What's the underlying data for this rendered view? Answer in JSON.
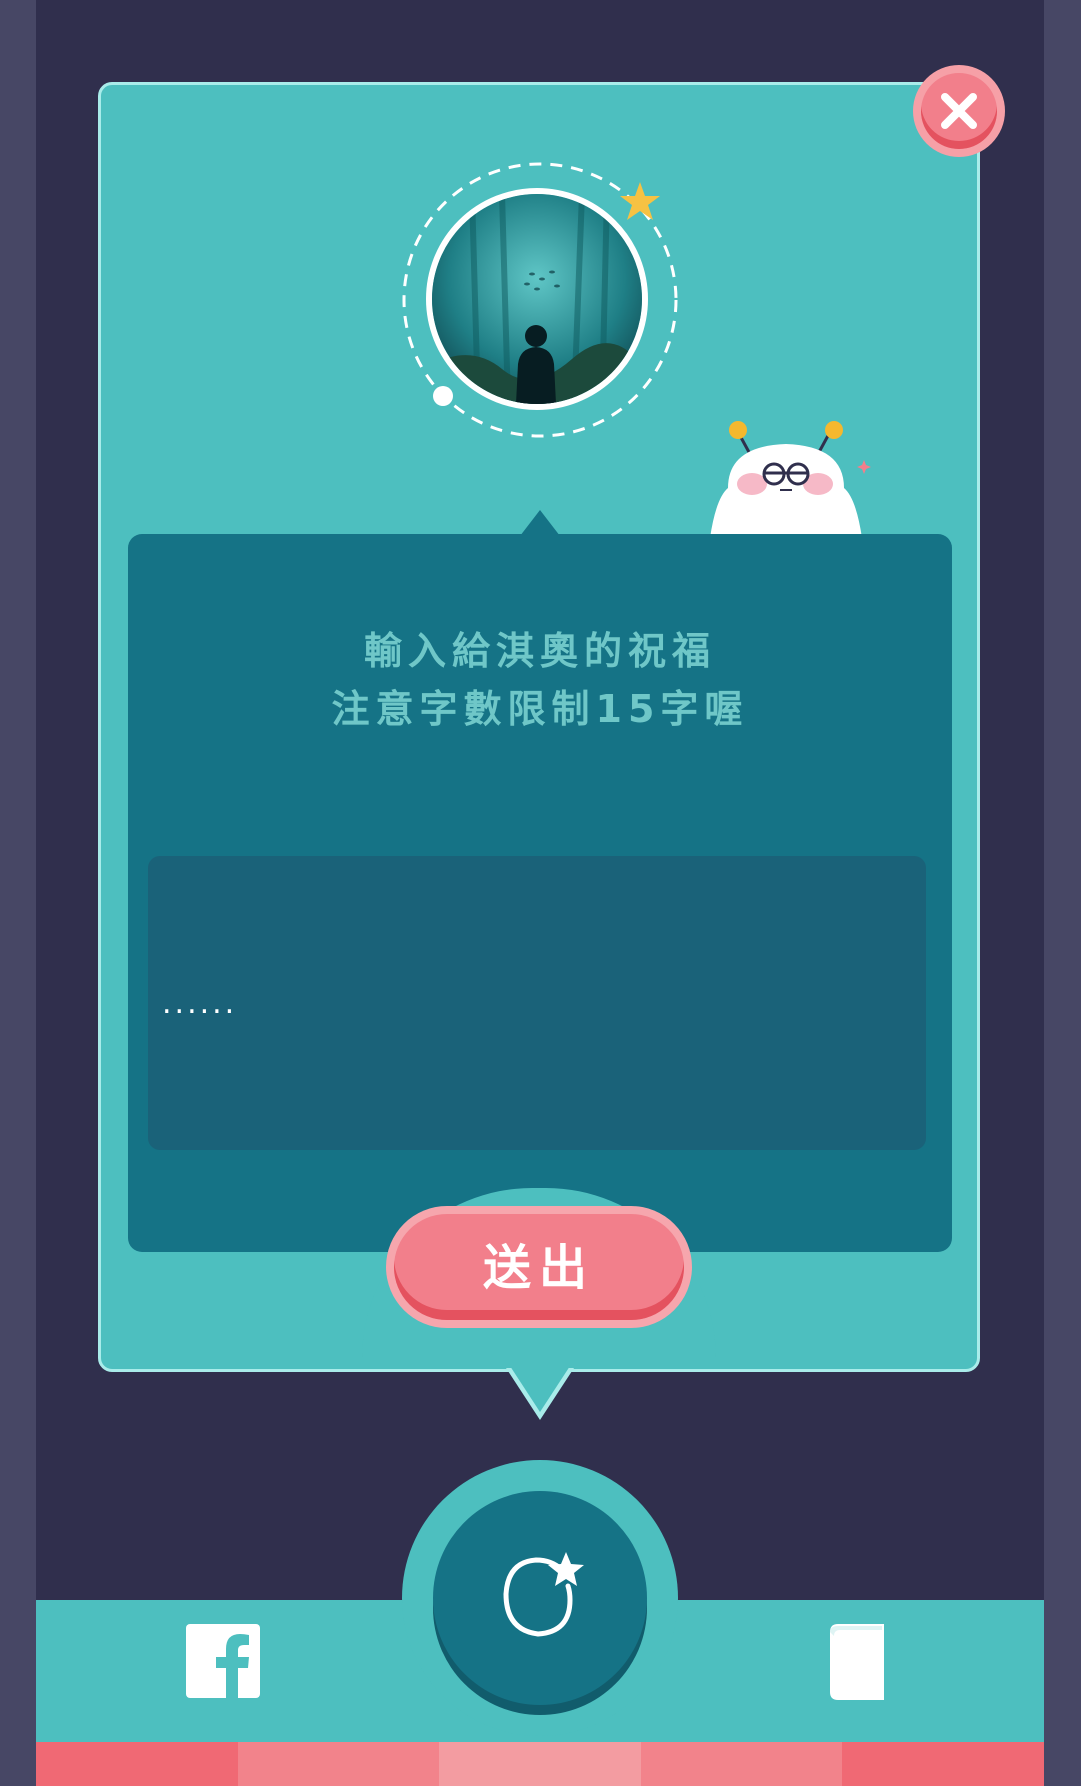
{
  "modal": {
    "prompt_line1": "輸入給淇奧的祝福",
    "prompt_line2": "注意字數限制15字喔",
    "input_placeholder": "......",
    "send_label": "送出"
  },
  "icons": {
    "close": "close-icon",
    "star": "star-icon",
    "mascot": "mascot-character",
    "center_nav": "wish-orb-icon",
    "facebook": "facebook-icon",
    "book": "book-icon"
  },
  "colors": {
    "background": "#302f4d",
    "card": "#4dbfbf",
    "panel": "#157386",
    "input": "#1a6279",
    "accent": "#f27f8b",
    "prompt_text": "#6fc7c8"
  },
  "footer_stripes": [
    "#f06974",
    "#f2838b",
    "#f39ca1",
    "#f2838b",
    "#f06974"
  ]
}
